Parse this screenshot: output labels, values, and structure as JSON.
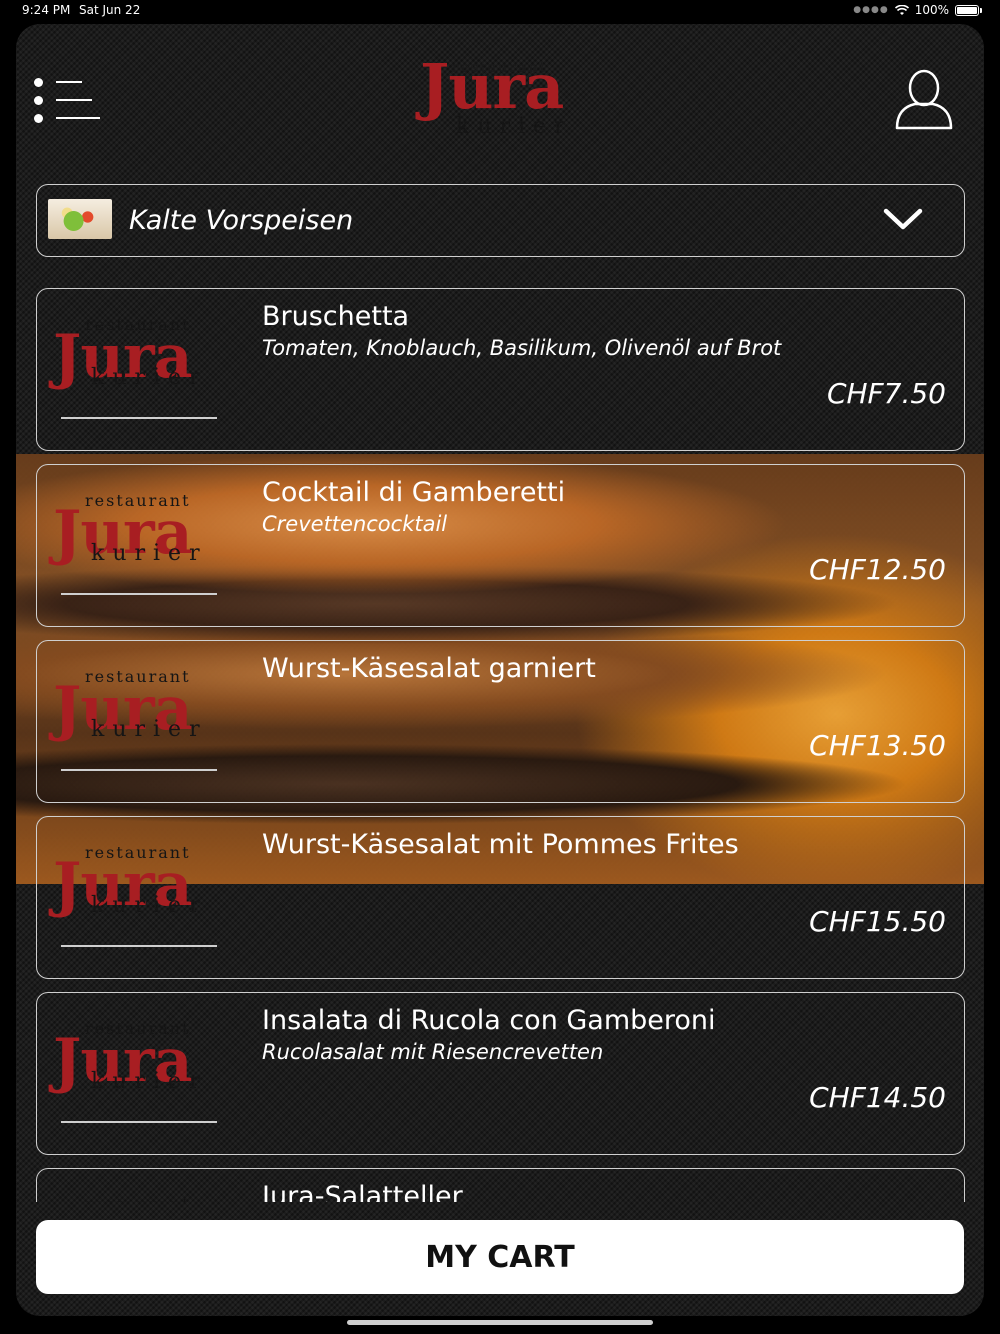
{
  "status_bar": {
    "time": "9:24 PM",
    "date": "Sat Jun 22",
    "battery": "100%"
  },
  "header": {
    "logo": {
      "restaurant": "restaurant",
      "word": "Jura",
      "kurier": "kurier"
    }
  },
  "category": {
    "label": "Kalte Vorspeisen"
  },
  "items": [
    {
      "name": "Bruschetta",
      "desc": "Tomaten, Knoblauch, Basilikum, Olivenöl auf Brot",
      "price": "CHF7.50"
    },
    {
      "name": "Cocktail di Gamberetti",
      "desc": "Crevettencocktail",
      "price": "CHF12.50"
    },
    {
      "name": "Wurst-Käsesalat garniert",
      "desc": "",
      "price": "CHF13.50"
    },
    {
      "name": "Wurst-Käsesalat mit Pommes Frites",
      "desc": "",
      "price": "CHF15.50"
    },
    {
      "name": "Insalata di Rucola con Gamberoni",
      "desc": "Rucolasalat mit Riesencrevetten",
      "price": "CHF14.50"
    },
    {
      "name": "Jura-Salatteller",
      "desc": "",
      "price": ""
    }
  ],
  "cart": {
    "label": "MY CART"
  }
}
